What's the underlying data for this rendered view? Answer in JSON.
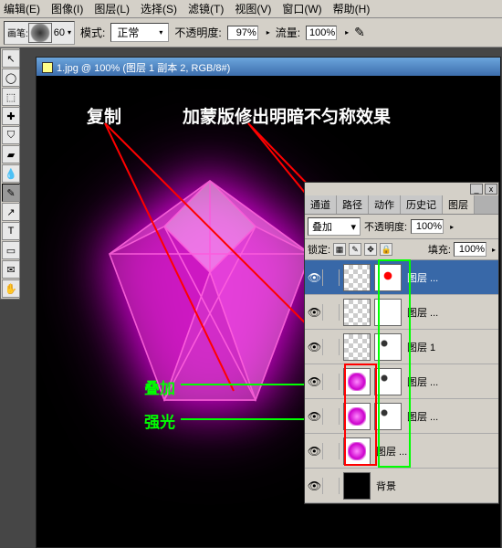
{
  "menu": {
    "edit": "编辑(E)",
    "image": "图像(I)",
    "layer": "图层(L)",
    "select": "选择(S)",
    "filter": "滤镜(T)",
    "view": "视图(V)",
    "window": "窗口(W)",
    "help": "帮助(H)"
  },
  "options": {
    "brush_label": "画笔:",
    "brush_size": "60",
    "mode_label": "模式:",
    "mode_value": "正常",
    "opacity_label": "不透明度:",
    "opacity_value": "97%",
    "flow_label": "流量:",
    "flow_value": "100%"
  },
  "doc": {
    "title": "1.jpg @ 100% (图层 1 副本 2, RGB/8#)"
  },
  "annotations": {
    "copy": "复制",
    "mask_effect": "加蒙版修出明暗不匀称效果",
    "overlay": "叠加",
    "hardlight": "强光"
  },
  "panel": {
    "tabs": {
      "channel": "通道",
      "path": "路径",
      "action": "动作",
      "history": "历史记",
      "layer": "图层"
    },
    "blend_mode": "叠加",
    "opacity_label": "不透明度:",
    "opacity_value": "100%",
    "lock_label": "锁定:",
    "fill_label": "填充:",
    "fill_value": "100%"
  },
  "layers": [
    {
      "name": "图层 ...",
      "sel": true,
      "thumb": "checker",
      "mask": "red-dot"
    },
    {
      "name": "图层 ...",
      "sel": false,
      "thumb": "checker",
      "mask": "white"
    },
    {
      "name": "图层  1",
      "sel": false,
      "thumb": "checker",
      "mask": "spotty"
    },
    {
      "name": "图层 ...",
      "sel": false,
      "thumb": "diamond",
      "mask": "spotty"
    },
    {
      "name": "图层 ...",
      "sel": false,
      "thumb": "diamond",
      "mask": "spotty"
    },
    {
      "name": "图层 ...",
      "sel": false,
      "thumb": "diamond",
      "mask": null
    },
    {
      "name": "背景",
      "sel": false,
      "thumb": "black",
      "mask": null
    }
  ]
}
